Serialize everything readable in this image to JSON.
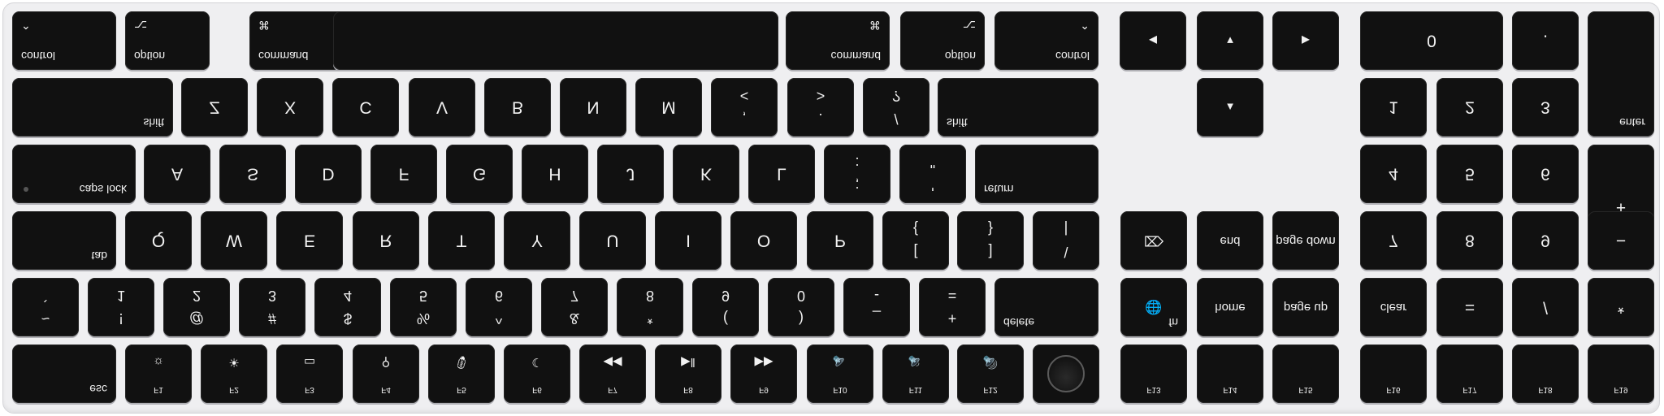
{
  "keyboard": {
    "rows": [
      {
        "name": "modifier-row",
        "keys": [
          {
            "id": "control-left",
            "tl": "control",
            "bl": "⌃"
          },
          {
            "id": "option-left",
            "tl": "option",
            "bl": "⌥"
          },
          {
            "id": "command-left",
            "tl": "command",
            "bl": "⌘"
          },
          {
            "id": "space"
          },
          {
            "id": "command-right",
            "tr": "command",
            "br": "⌘"
          },
          {
            "id": "option-right",
            "tr": "option",
            "br": "⌥"
          },
          {
            "id": "control-right",
            "tr": "control",
            "br": "⌃"
          },
          {
            "id": "arrow-left",
            "c": "◀",
            "arrow": true
          },
          {
            "id": "arrow-down",
            "c": "▼",
            "arrow": true
          },
          {
            "id": "arrow-right",
            "c": "▶",
            "arrow": true
          },
          {
            "id": "num-0",
            "c": "0"
          },
          {
            "id": "num-decimal",
            "c": "."
          },
          {
            "id": "num-enter",
            "tr": "enter"
          }
        ]
      },
      {
        "name": "shift-row",
        "keys": [
          {
            "id": "shift-left",
            "tr": "shift"
          },
          {
            "id": "z",
            "c": "Z"
          },
          {
            "id": "x",
            "c": "X"
          },
          {
            "id": "c",
            "c": "C"
          },
          {
            "id": "v",
            "c": "V"
          },
          {
            "id": "b",
            "c": "B"
          },
          {
            "id": "n",
            "c": "N"
          },
          {
            "id": "m",
            "c": "M"
          },
          {
            "id": "comma",
            "t": ",",
            "b": "<"
          },
          {
            "id": "period",
            "t": ".",
            "b": ">"
          },
          {
            "id": "slash",
            "t": "/",
            "b": "?"
          },
          {
            "id": "shift-right",
            "tl": "shift"
          },
          {
            "id": "arrow-up",
            "c": "▲",
            "arrow": true
          },
          {
            "id": "num-1",
            "c": "1"
          },
          {
            "id": "num-2",
            "c": "2"
          },
          {
            "id": "num-3",
            "c": "3"
          }
        ]
      },
      {
        "name": "home-row",
        "keys": [
          {
            "id": "caps-lock",
            "tr": "caps lock",
            "caps": true
          },
          {
            "id": "a",
            "c": "A"
          },
          {
            "id": "s",
            "c": "S"
          },
          {
            "id": "d",
            "c": "D"
          },
          {
            "id": "f",
            "c": "F"
          },
          {
            "id": "g",
            "c": "G"
          },
          {
            "id": "h",
            "c": "H"
          },
          {
            "id": "j",
            "c": "J"
          },
          {
            "id": "k",
            "c": "K"
          },
          {
            "id": "l",
            "c": "L"
          },
          {
            "id": "semicolon",
            "t": ";",
            "b": ":"
          },
          {
            "id": "quote",
            "t": "'",
            "b": "\""
          },
          {
            "id": "return",
            "tl": "return"
          },
          {
            "id": "num-4",
            "c": "4"
          },
          {
            "id": "num-5",
            "c": "5"
          },
          {
            "id": "num-6",
            "c": "6"
          },
          {
            "id": "num-plus",
            "c": "+"
          }
        ]
      },
      {
        "name": "top-letter-row",
        "keys": [
          {
            "id": "tab",
            "tr": "tab"
          },
          {
            "id": "q",
            "c": "Q"
          },
          {
            "id": "w",
            "c": "W"
          },
          {
            "id": "e",
            "c": "E"
          },
          {
            "id": "r",
            "c": "R"
          },
          {
            "id": "t",
            "c": "T"
          },
          {
            "id": "y",
            "c": "Y"
          },
          {
            "id": "u",
            "c": "U"
          },
          {
            "id": "i",
            "c": "I"
          },
          {
            "id": "o",
            "c": "O"
          },
          {
            "id": "p",
            "c": "P"
          },
          {
            "id": "bracket-left",
            "t": "[",
            "b": "{"
          },
          {
            "id": "bracket-right",
            "t": "]",
            "b": "}"
          },
          {
            "id": "backslash",
            "t": "\\",
            "b": "|"
          },
          {
            "id": "forward-delete",
            "c": "⌦",
            "sym": true
          },
          {
            "id": "end",
            "c2": "end"
          },
          {
            "id": "page-down",
            "c2": "page down"
          },
          {
            "id": "num-7",
            "c": "7"
          },
          {
            "id": "num-8",
            "c": "8"
          },
          {
            "id": "num-9",
            "c": "9"
          },
          {
            "id": "num-minus",
            "c": "−"
          }
        ]
      },
      {
        "name": "number-row",
        "keys": [
          {
            "id": "grave",
            "t": "~",
            "b": "`"
          },
          {
            "id": "digit-1",
            "t": "!",
            "b": "1"
          },
          {
            "id": "digit-2",
            "t": "@",
            "b": "2"
          },
          {
            "id": "digit-3",
            "t": "#",
            "b": "3"
          },
          {
            "id": "digit-4",
            "t": "$",
            "b": "4"
          },
          {
            "id": "digit-5",
            "t": "%",
            "b": "5"
          },
          {
            "id": "digit-6",
            "t": "^",
            "b": "6"
          },
          {
            "id": "digit-7",
            "t": "&",
            "b": "7"
          },
          {
            "id": "digit-8",
            "t": "*",
            "b": "8"
          },
          {
            "id": "digit-9",
            "t": "(",
            "b": "9"
          },
          {
            "id": "digit-0",
            "t": ")",
            "b": "0"
          },
          {
            "id": "minus",
            "t": "_",
            "b": "-"
          },
          {
            "id": "equal",
            "t": "+",
            "b": "="
          },
          {
            "id": "delete",
            "tl": "delete"
          },
          {
            "id": "fn-globe",
            "tr": "fn",
            "c": "🌐",
            "sym": true
          },
          {
            "id": "home",
            "c2": "home"
          },
          {
            "id": "page-up",
            "c2": "page up"
          },
          {
            "id": "clear",
            "c2": "clear"
          },
          {
            "id": "num-equal",
            "c": "="
          },
          {
            "id": "num-divide",
            "c": "/"
          },
          {
            "id": "num-multiply",
            "c": "*"
          }
        ]
      },
      {
        "name": "function-row",
        "keys": [
          {
            "id": "esc",
            "tr": "esc"
          },
          {
            "id": "f1",
            "fc": "F1",
            "fi": "☼"
          },
          {
            "id": "f2",
            "fc": "F2",
            "fi": "☀"
          },
          {
            "id": "f3",
            "fc": "F3",
            "fi": "▭"
          },
          {
            "id": "f4",
            "fc": "F4",
            "fi": "⚲"
          },
          {
            "id": "f5",
            "fc": "F5",
            "fi": "🎙"
          },
          {
            "id": "f6",
            "fc": "F6",
            "fi": "☾"
          },
          {
            "id": "f7",
            "fc": "F7",
            "fi": "◀◀"
          },
          {
            "id": "f8",
            "fc": "F8",
            "fi": "▶‖"
          },
          {
            "id": "f9",
            "fc": "F9",
            "fi": "▶▶"
          },
          {
            "id": "f10",
            "fc": "F10",
            "fi": "🔈"
          },
          {
            "id": "f11",
            "fc": "F11",
            "fi": "🔉"
          },
          {
            "id": "f12",
            "fc": "F12",
            "fi": "🔊"
          },
          {
            "id": "touch-id",
            "touch": true
          },
          {
            "id": "f13",
            "fc": "F13"
          },
          {
            "id": "f14",
            "fc": "F14"
          },
          {
            "id": "f15",
            "fc": "F15"
          },
          {
            "id": "f16",
            "fc": "F16"
          },
          {
            "id": "f17",
            "fc": "F17"
          },
          {
            "id": "f18",
            "fc": "F18"
          },
          {
            "id": "f19",
            "fc": "F19"
          }
        ]
      }
    ]
  }
}
